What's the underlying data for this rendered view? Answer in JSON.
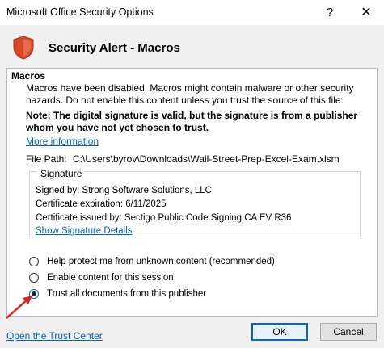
{
  "window": {
    "title": "Microsoft Office Security Options",
    "help": "?",
    "close": "✕"
  },
  "header": {
    "title": "Security Alert - Macros"
  },
  "macros": {
    "section": "Macros",
    "description": "Macros have been disabled. Macros might contain malware or other security hazards. Do not enable this content unless you trust the source of this file.",
    "note": "Note: The digital signature is valid, but the signature is from a publisher whom you have not yet chosen to trust.",
    "more_info": "More information",
    "file_path_label": "File Path:",
    "file_path": "C:\\Users\\byrov\\Downloads\\Wall-Street-Prep-Excel-Exam.xlsm"
  },
  "signature": {
    "legend": "Signature",
    "signed_by": "Signed by: Strong Software Solutions, LLC",
    "expiration": "Certificate expiration: 6/11/2025",
    "issued_by": "Certificate issued by: Sectigo Public Code Signing CA EV R36",
    "show_details": "Show Signature Details"
  },
  "options": [
    {
      "label": "Help protect me from unknown content (recommended)",
      "checked": false
    },
    {
      "label": "Enable content for this session",
      "checked": false
    },
    {
      "label": "Trust all documents from this publisher",
      "checked": true
    }
  ],
  "footer": {
    "trust_center": "Open the Trust Center",
    "ok": "OK",
    "cancel": "Cancel"
  },
  "colors": {
    "link": "#0563c1",
    "shield": "#d9472b",
    "accent": "#0a64c4",
    "arrow": "#e02020"
  }
}
